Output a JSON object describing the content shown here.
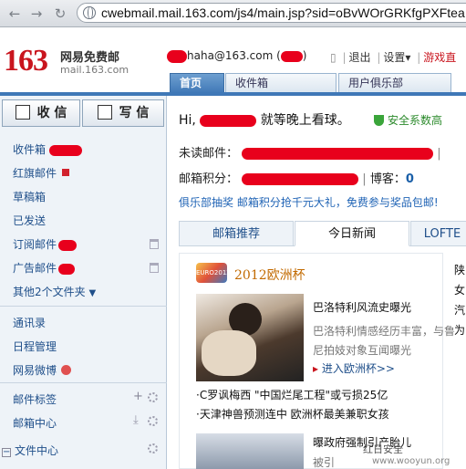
{
  "browser": {
    "url": "cwebmail.mail.163.com/js4/main.jsp?sid=oBvWOrGRKfgPXFtea"
  },
  "header": {
    "logo_number": "163",
    "logo_name": "网易免费邮",
    "logo_domain": "mail.163.com",
    "user_email": "haha@163.com",
    "paren_open": "(",
    "paren_close": ")",
    "links": [
      "退出",
      "设置",
      "游戏直"
    ],
    "settings_arrow": "▾"
  },
  "tabs": [
    {
      "label": "首页"
    },
    {
      "label": "收件箱"
    },
    {
      "label": "用户俱乐部"
    }
  ],
  "sidebar": {
    "receive": "收 信",
    "compose": "写 信",
    "folders": [
      "收件箱",
      "红旗邮件",
      "草稿箱",
      "已发送",
      "订阅邮件",
      "广告邮件",
      "其他2个文件夹"
    ],
    "other_arrow": "▼",
    "apps": [
      "通讯录",
      "日程管理",
      "网易微博"
    ],
    "sections": [
      "邮件标签",
      "邮箱中心",
      "文件中心"
    ],
    "collapse": "−"
  },
  "main": {
    "greeting": "Hi,",
    "greeting_tail": "就等晚上看球。",
    "safety": "安全系数高",
    "unread_label": "未读邮件：",
    "points_label": "邮箱积分：",
    "blog_label": "博客：",
    "blog_value": "0",
    "divider": "|",
    "promo": "俱乐部抽奖 邮箱积分抢千元大礼，免费参与奖品包邮!",
    "news_tabs": [
      "邮箱推荐",
      "今日新闻",
      "LOFTE"
    ],
    "euro_logo": "EURO2012",
    "euro_title": "2012欧洲杯",
    "headline1": "巴洛特利风流史曝光",
    "summary1": "巴洛特利情感经历丰富，与鲁尼拍妓对象互闻曝光",
    "more_link": "进入欧洲杯>>",
    "bullet1": "·C罗讽梅西 \"中国烂尾工程\"或亏损25亿",
    "bullet2": "·天津神兽预测连中 欧洲杯最美兼职女孩",
    "headline2": "曝政府强制引产胎儿",
    "summary2": "被引",
    "right_col": "陕女汽为"
  },
  "watermark": {
    "text": "红日安全",
    "site": "www.wooyun.org"
  },
  "colors": {
    "accent": "#3f78b7",
    "brand": "#c9151e",
    "redaction": "#e8001c"
  }
}
